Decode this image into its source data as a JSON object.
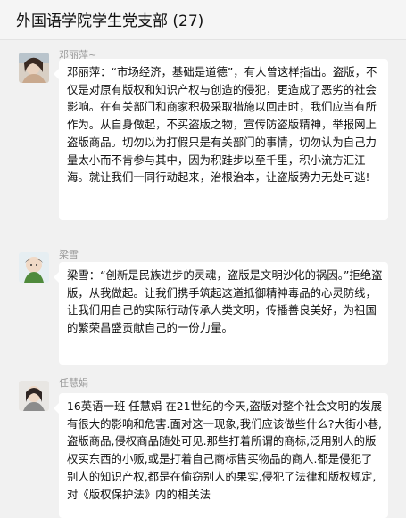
{
  "chat": {
    "title": "外国语学院学生党支部 (27)"
  },
  "messages": [
    {
      "sender": "邓丽萍~",
      "text": "邓丽萍：“市场经济，基础是道德”，有人曾这样指出。盗版，不仅是对原有版权和知识产权与创造的侵犯，更造成了恶劣的社会影响。在有关部门和商家积极采取措施以回击时，我们应当有所作为。从自身做起，不买盗版之物，宣传防盗版精神，举报网上盗版商品。切勿以为打假只是有关部门的事情，切勿认为自己力量太小而不肯参与其中，因为积跬步以至千里，积小流方汇江海。就让我们一同行动起来，治根治本，让盗版势力无处可逃!"
    },
    {
      "sender": "梁雪",
      "text": "梁雪：“创新是民族进步的灵魂，盗版是文明沙化的祸因。”拒绝盗版，从我做起。让我们携手筑起这道抵御精神毒品的心灵防线，让我们用自己的实际行动传承人类文明，传播善良美好，为祖国的繁荣昌盛贡献自己的一份力量。"
    },
    {
      "sender": "任慧娟",
      "text": "16英语一班 任慧娟 在21世纪的今天,盗版对整个社会文明的发展有很大的影响和危害.面对这一现象,我们应该做些什么?大街小巷,盗版商品,侵权商品随处可见.那些打着所谓的商标,泛用别人的版权买东西的小贩,或是打着自己商标售买物品的商人.都是侵犯了别人的知识产权,都是在偷窃别人的果实,侵犯了法律和版权规定,对《版权保护法》内的相关法"
    }
  ]
}
